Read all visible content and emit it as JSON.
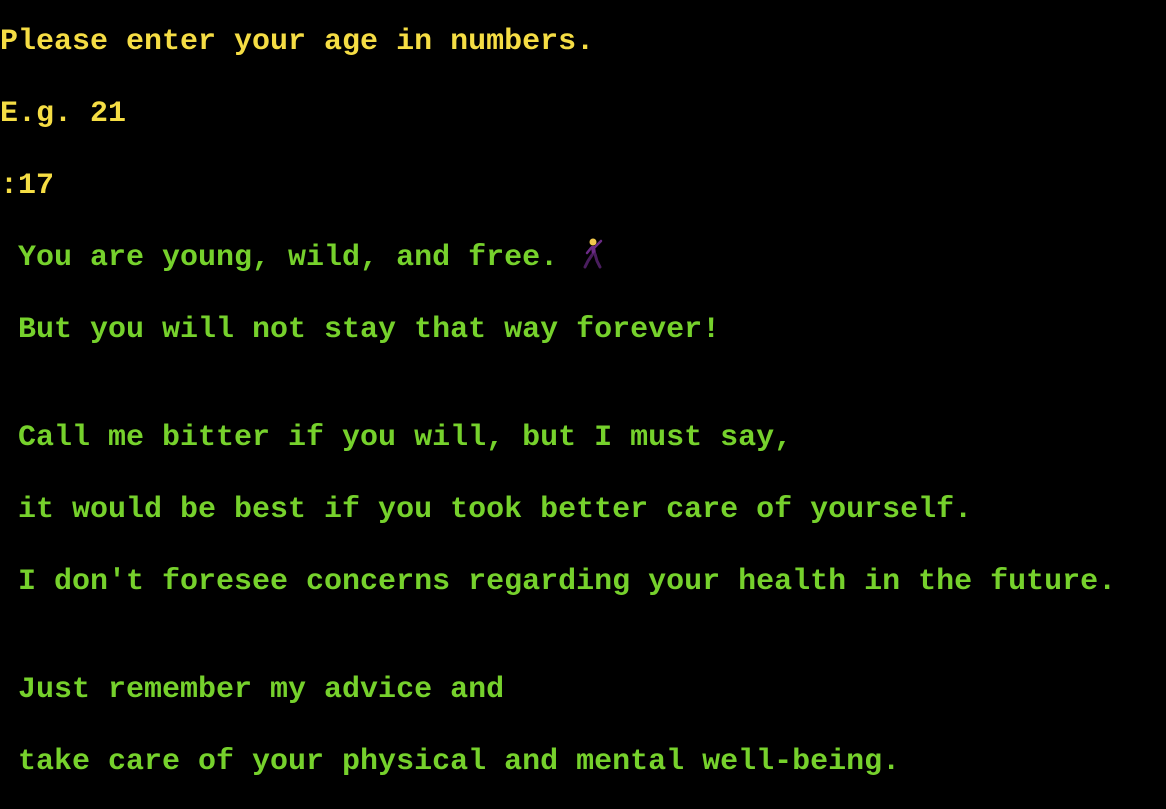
{
  "terminal": {
    "prompt_lines": [
      "Please enter your age in numbers.",
      "E.g. 21",
      ":17"
    ],
    "reply_lines": [
      " You are young, wild, and free.",
      " But you will not stay that way forever!",
      " Call me bitter if you will, but I must say,",
      " it would be best if you took better care of yourself.",
      " I don't foresee concerns regarding your health in the future.",
      " Just remember my advice and",
      " take care of your physical and mental well-being."
    ],
    "dancer_icon": "dancing-person-icon",
    "colors": {
      "background": "#000000",
      "prompt": "#f5dd44",
      "reply": "#76d12c"
    }
  }
}
